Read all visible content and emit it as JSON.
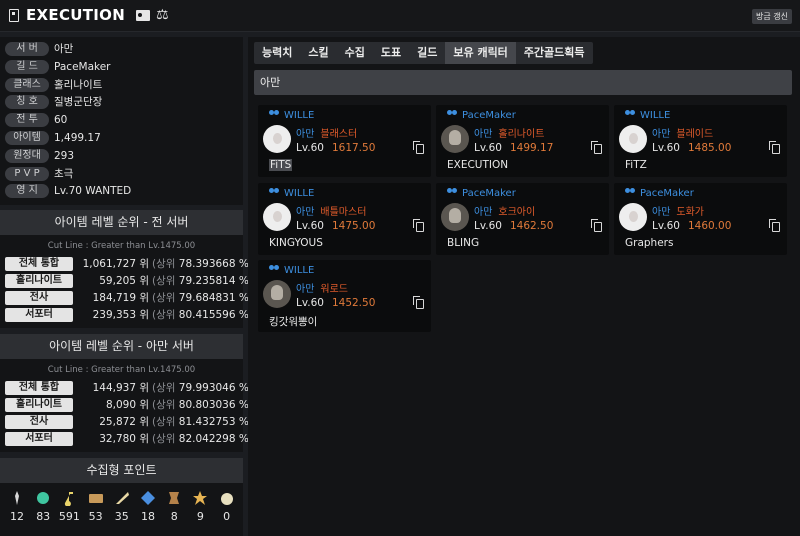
{
  "header": {
    "name": "EXECUTION",
    "refresh_label": "방금 갱신"
  },
  "profile": [
    {
      "label": "서 버",
      "value": "아만"
    },
    {
      "label": "길 드",
      "value": "PaceMaker"
    },
    {
      "label": "클래스",
      "value": "홀리나이트"
    },
    {
      "label": "칭 호",
      "value": "질병군단장"
    },
    {
      "label": "전 투",
      "value": "60"
    },
    {
      "label": "아이템",
      "value": "1,499.17"
    },
    {
      "label": "원정대",
      "value": "293"
    },
    {
      "label": "P V P",
      "value": "초극"
    },
    {
      "label": "영 지",
      "value": "Lv.70 WANTED"
    }
  ],
  "ranking_all": {
    "title": "아이템 레벨 순위 - 전 서버",
    "cutline": "Cut Line : Greater than Lv.1475.00",
    "rows": [
      {
        "label": "전체 통합",
        "rank": "1,061,727 위",
        "pct": "78.393668 %"
      },
      {
        "label": "홀리나이트",
        "rank": "59,205 위",
        "pct": "79.235814 %"
      },
      {
        "label": "전사",
        "rank": "184,719 위",
        "pct": "79.684831 %"
      },
      {
        "label": "서포터",
        "rank": "239,353 위",
        "pct": "80.415596 %"
      }
    ]
  },
  "ranking_server": {
    "title": "아이템 레벨 순위 - 아만 서버",
    "cutline": "Cut Line : Greater than Lv.1475.00",
    "rows": [
      {
        "label": "전체 통합",
        "rank": "144,937 위",
        "pct": "79.993046 %"
      },
      {
        "label": "홀리나이트",
        "rank": "8,090 위",
        "pct": "80.803036 %"
      },
      {
        "label": "전사",
        "rank": "25,872 위",
        "pct": "81.432753 %"
      },
      {
        "label": "서포터",
        "rank": "32,780 위",
        "pct": "82.042298 %"
      }
    ]
  },
  "ranking_words": {
    "open": "(상위",
    "close": ")"
  },
  "collect": {
    "title": "수집형 포인트",
    "items": [
      {
        "icon": "island-heart-icon",
        "count": "12",
        "color": "#d8d8d8"
      },
      {
        "icon": "orb-icon",
        "count": "83",
        "color": "#3fc6a0"
      },
      {
        "icon": "note-icon",
        "count": "591",
        "color": "#e9d46a"
      },
      {
        "icon": "art-icon",
        "count": "53",
        "color": "#c89a5a"
      },
      {
        "icon": "feather-icon",
        "count": "35",
        "color": "#e9d9a6"
      },
      {
        "icon": "leaf-icon",
        "count": "18",
        "color": "#4a8fe0"
      },
      {
        "icon": "medal-icon",
        "count": "8",
        "color": "#b5824a"
      },
      {
        "icon": "star-icon",
        "count": "9",
        "color": "#e7b453"
      },
      {
        "icon": "seed-icon",
        "count": "0",
        "color": "#e8e0c0"
      }
    ]
  },
  "tabs": [
    "능력치",
    "스킬",
    "수집",
    "도표",
    "길드",
    "보유 캐릭터",
    "주간골드획득"
  ],
  "active_tab": "보유 캐릭터",
  "server_bar": "아만",
  "characters": [
    {
      "guild": "WILLE",
      "server": "아만",
      "class": "블래스터",
      "level": "Lv.60",
      "ilvl": "1617.50",
      "nick": "FiTS",
      "highlight": true,
      "avatar": "light"
    },
    {
      "guild": "PaceMaker",
      "server": "아만",
      "class": "홀리나이트",
      "level": "Lv.60",
      "ilvl": "1499.17",
      "nick": "EXECUTION",
      "highlight": false,
      "avatar": "dark"
    },
    {
      "guild": "WILLE",
      "server": "아만",
      "class": "블레이드",
      "level": "Lv.60",
      "ilvl": "1485.00",
      "nick": "FiTZ",
      "highlight": false,
      "avatar": "light"
    },
    {
      "guild": "WILLE",
      "server": "아만",
      "class": "배틀마스터",
      "level": "Lv.60",
      "ilvl": "1475.00",
      "nick": "KINGYOUS",
      "highlight": false,
      "avatar": "light"
    },
    {
      "guild": "PaceMaker",
      "server": "아만",
      "class": "호크아이",
      "level": "Lv.60",
      "ilvl": "1462.50",
      "nick": "BLING",
      "highlight": false,
      "avatar": "dark"
    },
    {
      "guild": "PaceMaker",
      "server": "아만",
      "class": "도화가",
      "level": "Lv.60",
      "ilvl": "1460.00",
      "nick": "Graphers",
      "highlight": false,
      "avatar": "light"
    },
    {
      "guild": "WILLE",
      "server": "아만",
      "class": "워로드",
      "level": "Lv.60",
      "ilvl": "1452.50",
      "nick": "킹갓워뽕이",
      "highlight": false,
      "avatar": "dark"
    }
  ]
}
